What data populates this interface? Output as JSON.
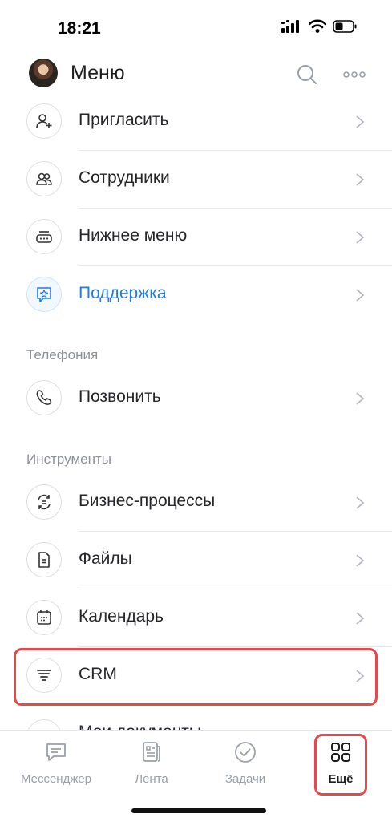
{
  "status_bar": {
    "time": "18:21",
    "signal_icon": "cellular-signal-icon",
    "wifi_icon": "wifi-icon",
    "battery_icon": "battery-icon"
  },
  "header": {
    "title": "Меню",
    "search_icon": "search-icon",
    "more_icon": "more-dots-icon"
  },
  "menu": {
    "items": [
      {
        "label": "Пригласить",
        "icon": "add-user-icon"
      },
      {
        "label": "Сотрудники",
        "icon": "employees-icon"
      },
      {
        "label": "Нижнее меню",
        "icon": "bottom-menu-icon"
      },
      {
        "label": "Поддержка",
        "icon": "support-star-icon"
      }
    ],
    "telephony": {
      "title": "Телефония",
      "items": [
        {
          "label": "Позвонить",
          "icon": "phone-icon"
        }
      ]
    },
    "tools": {
      "title": "Инструменты",
      "items": [
        {
          "label": "Бизнес-процессы",
          "icon": "business-process-icon"
        },
        {
          "label": "Файлы",
          "icon": "file-icon"
        },
        {
          "label": "Календарь",
          "icon": "calendar-icon"
        },
        {
          "label": "CRM",
          "icon": "crm-funnel-icon"
        },
        {
          "label": "Мои документы",
          "icon": "documents-pen-icon"
        }
      ]
    }
  },
  "tabbar": {
    "tabs": [
      {
        "label": "Мессенджер",
        "icon": "chat-icon"
      },
      {
        "label": "Лента",
        "icon": "feed-icon"
      },
      {
        "label": "Задачи",
        "icon": "tasks-check-icon"
      },
      {
        "label": "Ещё",
        "icon": "grid-icon",
        "active": true
      }
    ]
  },
  "colors": {
    "accent": "#1f7be5",
    "highlight": "#e8474c",
    "muted": "#8b8f96"
  }
}
